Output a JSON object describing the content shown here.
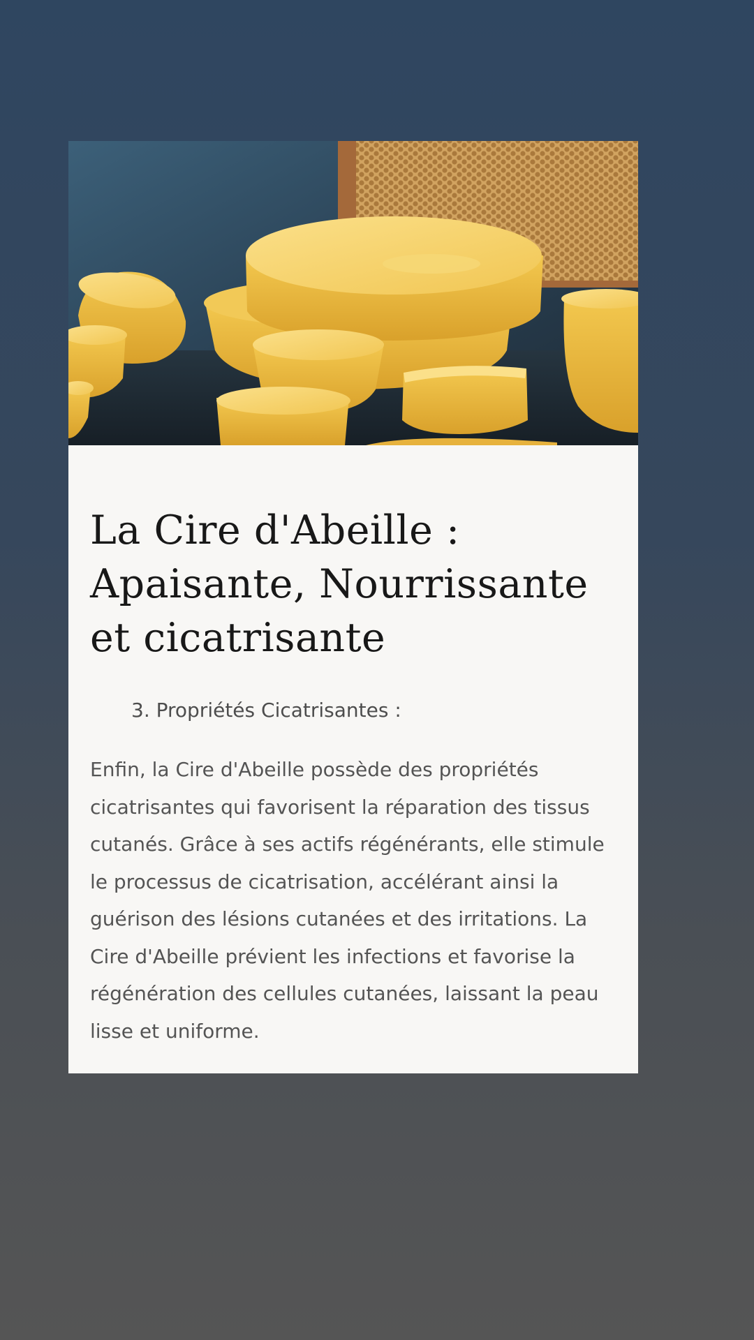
{
  "article": {
    "image_alt": "Blocs de cire d'abeille jaune devant un cadre de rayon de miel",
    "title": "La Cire d'Abeille : Apaisante, Nourrissante et cicatrisante",
    "subtitle": "3. Propriétés Cicatrisantes :",
    "body": "Enfin, la Cire d'Abeille possède des propriétés cicatrisantes qui favorisent la réparation des tissus cutanés. Grâce à ses actifs régénérants, elle stimule le processus de cicatrisation, accélérant ainsi la guérison des lésions cutanées et des irritations. La Cire d'Abeille prévient les infections et favorise la régénération des cellules cutanées, laissant la peau lisse et uniforme."
  },
  "colors": {
    "background_top": "#2f4660",
    "background_bottom": "#555555",
    "card": "#f8f7f5",
    "wax": "#f0c24a",
    "title_text": "#181818",
    "body_text": "#545454"
  }
}
